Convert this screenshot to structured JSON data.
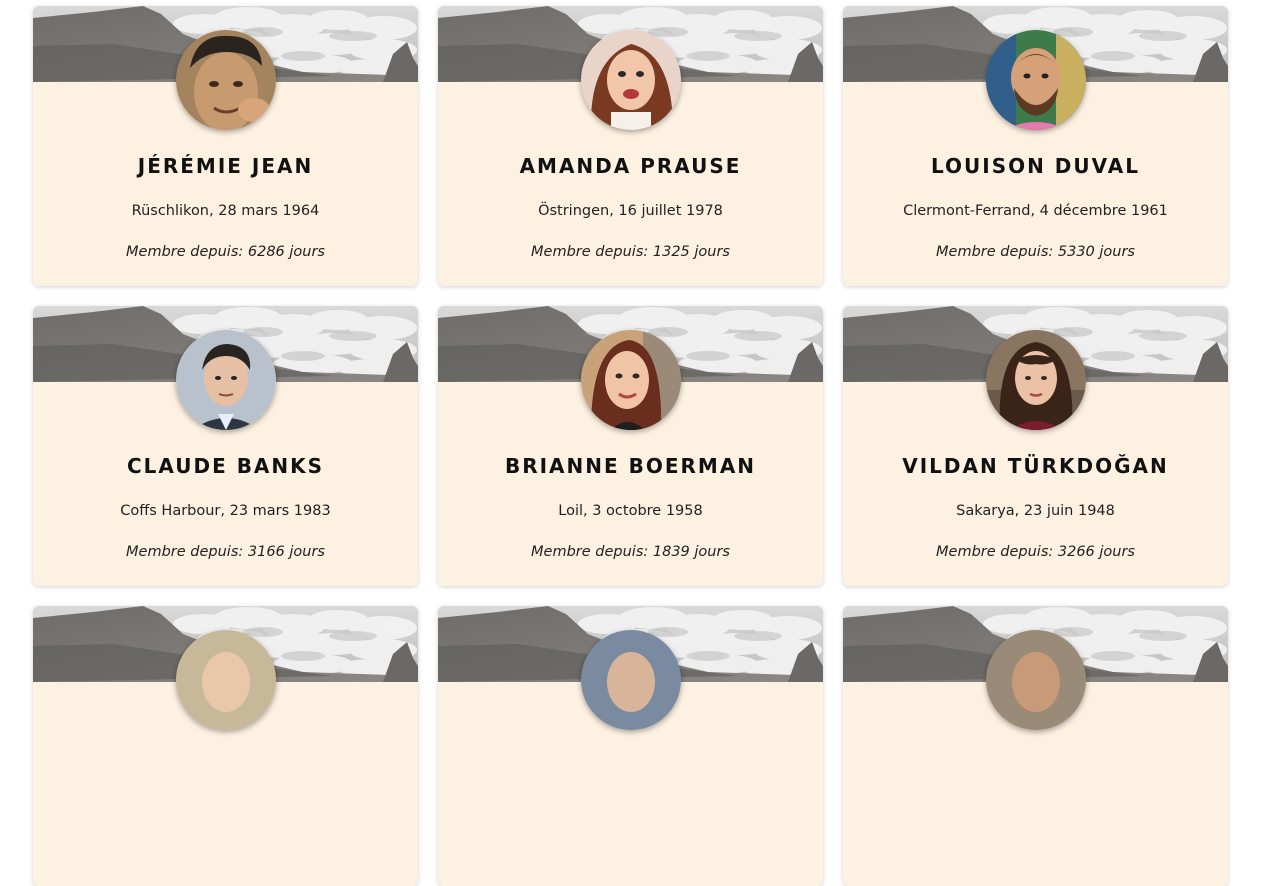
{
  "members": [
    {
      "name": "Jérémie Jean",
      "origin": "Rüschlikon, 28 mars 1964",
      "member_since": "Membre depuis: 6286 jours",
      "avatar": "avatar-man-dark-hair"
    },
    {
      "name": "Amanda Prause",
      "origin": "Östringen, 16 juillet 1978",
      "member_since": "Membre depuis: 1325 jours",
      "avatar": "avatar-woman-brown-hair"
    },
    {
      "name": "Louison Duval",
      "origin": "Clermont-Ferrand, 4 décembre 1961",
      "member_since": "Membre depuis: 5330 jours",
      "avatar": "avatar-man-beard"
    },
    {
      "name": "Claude Banks",
      "origin": "Coffs Harbour, 23 mars 1983",
      "member_since": "Membre depuis: 3166 jours",
      "avatar": "avatar-man-suit"
    },
    {
      "name": "Brianne Boerman",
      "origin": "Loil, 3 octobre 1958",
      "member_since": "Membre depuis: 1839 jours",
      "avatar": "avatar-woman-long-hair"
    },
    {
      "name": "Vildan Türkdoğan",
      "origin": "Sakarya, 23 juin 1948",
      "member_since": "Membre depuis: 3266 jours",
      "avatar": "avatar-woman-dark-hair"
    }
  ],
  "colors": {
    "card_background": "#fdf1e2",
    "name_text": "#111111",
    "body_text": "#222222"
  }
}
